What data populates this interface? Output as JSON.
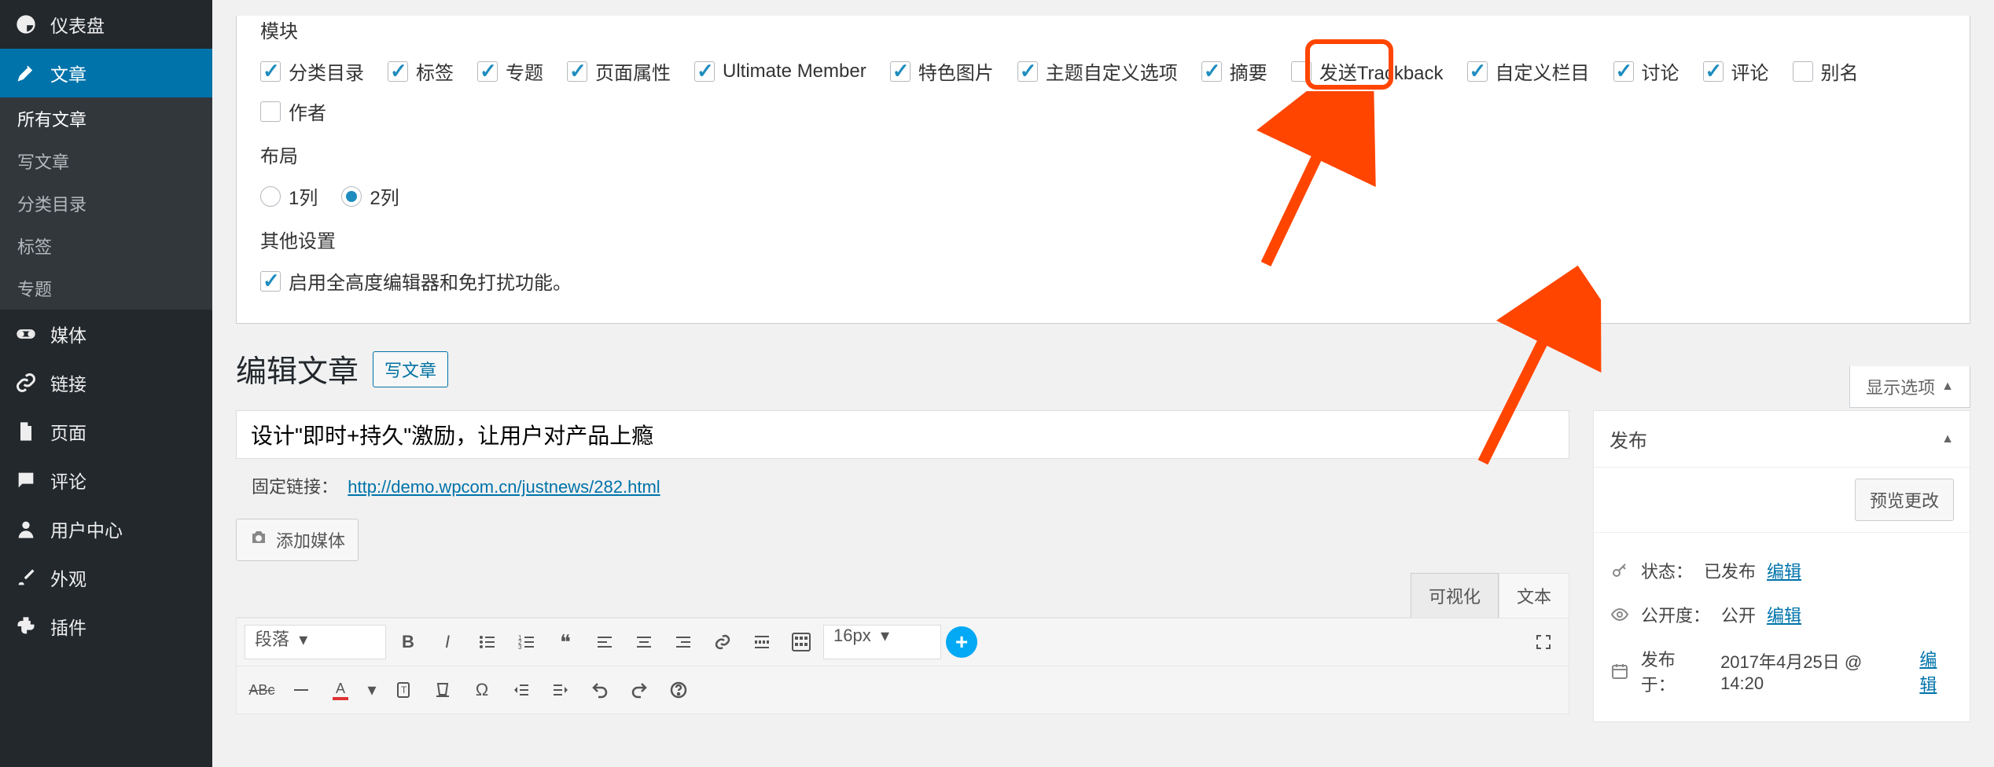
{
  "sidebar": {
    "dashboard": "仪表盘",
    "posts": "文章",
    "posts_sub": {
      "all": "所有文章",
      "new": "写文章",
      "cat": "分类目录",
      "tag": "标签",
      "topic": "专题"
    },
    "media": "媒体",
    "links": "链接",
    "pages": "页面",
    "comments": "评论",
    "users": "用户中心",
    "appearance": "外观",
    "plugins": "插件"
  },
  "screen_options": {
    "h_modules": "模块",
    "modules": [
      "分类目录",
      "标签",
      "专题",
      "页面属性",
      "Ultimate Member",
      "特色图片",
      "主题自定义选项",
      "摘要",
      "发送Trackback",
      "自定义栏目",
      "讨论",
      "评论",
      "别名",
      "作者"
    ],
    "modules_checked": [
      true,
      true,
      true,
      true,
      true,
      true,
      true,
      true,
      false,
      true,
      true,
      true,
      false,
      false
    ],
    "h_layout": "布局",
    "layout_options": [
      "1列",
      "2列"
    ],
    "h_other": "其他设置",
    "other_label": "启用全高度编辑器和免打扰功能。",
    "tab_label": "显示选项"
  },
  "page": {
    "title": "编辑文章",
    "new_post_btn": "写文章",
    "post_title": "设计\"即时+持久\"激励，让用户对产品上瘾",
    "permalink_label": "固定链接：",
    "permalink_url": "http://demo.wpcom.cn/justnews/282.html",
    "add_media": "添加媒体",
    "editor_tabs": {
      "visual": "可视化",
      "text": "文本"
    },
    "toolbar": {
      "format_select": "段落",
      "fontsize_select": "16px"
    }
  },
  "publish": {
    "box_title": "发布",
    "preview_btn": "预览更改",
    "status_label": "状态：",
    "status_value": "已发布",
    "edit": "编辑",
    "visibility_label": "公开度：",
    "visibility_value": "公开",
    "published_label": "发布于：",
    "published_value": "2017年4月25日 @ 14:20"
  }
}
